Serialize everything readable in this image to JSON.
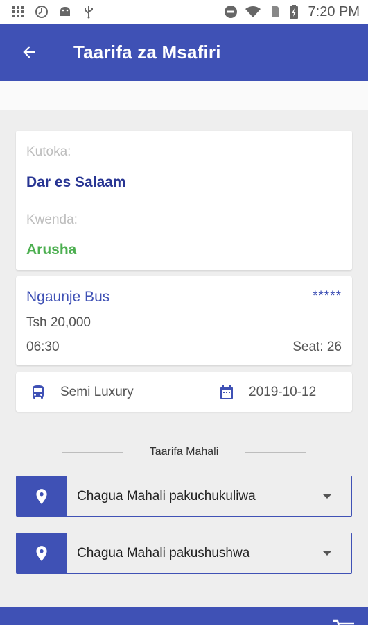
{
  "status_bar": {
    "time": "7:20 PM",
    "icons": [
      "grid-icon",
      "clock-icon",
      "android-icon",
      "usb-icon",
      "dnd-icon",
      "wifi-icon",
      "sim-icon",
      "battery-charging-icon"
    ]
  },
  "app_bar": {
    "title": "Taarifa za Msafiri",
    "back_icon": "arrow-back-icon"
  },
  "route": {
    "from_label": "Kutoka:",
    "from_value": "Dar es Salaam",
    "to_label": "Kwenda:",
    "to_value": "Arusha"
  },
  "bus": {
    "name": "Ngaunje Bus",
    "rating": "*****",
    "price": "Tsh 20,000",
    "time": "06:30",
    "seat": "Seat: 26"
  },
  "trip_info": {
    "class_icon": "bus-icon",
    "class": "Semi Luxury",
    "date_icon": "calendar-icon",
    "date": "2019-10-12"
  },
  "location_section": {
    "title": "Taarifa Mahali",
    "pickup_placeholder": "Chagua Mahali pakuchukuliwa",
    "dropoff_placeholder": "Chagua Mahali pakushushwa",
    "pin_icon": "location-pin-icon",
    "arrow_icon": "dropdown-arrow-icon"
  },
  "bottom_bar": {
    "icon": "cart-icon"
  },
  "colors": {
    "primary": "#3f51b5",
    "from_text": "#283593",
    "to_text": "#4caf50",
    "background": "#eeeeee"
  }
}
